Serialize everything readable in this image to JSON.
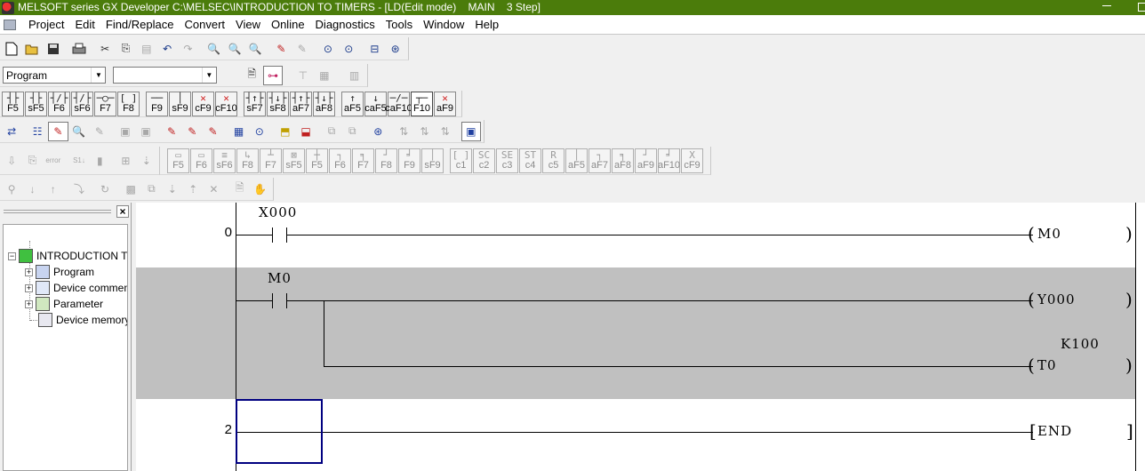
{
  "window": {
    "title": "MELSOFT series GX Developer C:\\MELSEC\\INTRODUCTION TO TIMERS - [LD(Edit mode)    MAIN    3 Step]"
  },
  "menu": [
    "Project",
    "Edit",
    "Find/Replace",
    "Convert",
    "View",
    "Online",
    "Diagnostics",
    "Tools",
    "Window",
    "Help"
  ],
  "toolbar1": {
    "buttons": [
      "new-icon",
      "open-icon",
      "save-icon",
      "print-icon",
      "cut-icon",
      "copy-icon",
      "paste-icon",
      "undo-icon",
      "redo-icon",
      "device-search-icon",
      "instruction-search-icon",
      "character-search-icon",
      "device-replace-icon",
      "instruction-replace-icon",
      "monitor-zoom-icon",
      "monitor-zoom2-icon",
      "display-icon",
      "check-icon"
    ]
  },
  "toolbar2": {
    "data_type": "Program",
    "program_select": ""
  },
  "fkeys_ladder": [
    {
      "sym": "┤├",
      "key": "F5"
    },
    {
      "sym": "┤├",
      "key": "sF5"
    },
    {
      "sym": "┤/├",
      "key": "F6"
    },
    {
      "sym": "┤/├",
      "key": "sF6"
    },
    {
      "sym": "─○─",
      "key": "F7"
    },
    {
      "sym": "[ ]",
      "key": "F8"
    },
    {
      "sym": "──",
      "key": "F9"
    },
    {
      "sym": "│",
      "key": "sF9"
    },
    {
      "sym": "✕",
      "key": "cF9"
    },
    {
      "sym": "✕",
      "key": "cF10"
    },
    {
      "sym": "┤↑├",
      "key": "sF7"
    },
    {
      "sym": "┤↓├",
      "key": "sF8"
    },
    {
      "sym": "┤↑├",
      "key": "aF7"
    },
    {
      "sym": "┤↓├",
      "key": "aF8"
    },
    {
      "sym": "↑",
      "key": "aF5"
    },
    {
      "sym": "↓",
      "key": "caF5"
    },
    {
      "sym": "─/─",
      "key": "caF10"
    },
    {
      "sym": "┬─",
      "key": "F10"
    },
    {
      "sym": "✕",
      "key": "aF9"
    }
  ],
  "fkeys_sfc": [
    {
      "sym": "▭",
      "key": "F5"
    },
    {
      "sym": "▭",
      "key": "F6"
    },
    {
      "sym": "≡",
      "key": "sF6"
    },
    {
      "sym": "↳",
      "key": "F8"
    },
    {
      "sym": "┴",
      "key": "F7"
    },
    {
      "sym": "⊠",
      "key": "sF5"
    },
    {
      "sym": "┼",
      "key": "F5"
    },
    {
      "sym": "┐",
      "key": "F6"
    },
    {
      "sym": "╕",
      "key": "F7"
    },
    {
      "sym": "┘",
      "key": "F8"
    },
    {
      "sym": "╛",
      "key": "F9"
    },
    {
      "sym": "│",
      "key": "sF9"
    },
    {
      "sym": "[ ]",
      "key": "c1"
    },
    {
      "sym": "SC",
      "key": "c2"
    },
    {
      "sym": "SE",
      "key": "c3"
    },
    {
      "sym": "ST",
      "key": "c4"
    },
    {
      "sym": "R",
      "key": "c5"
    },
    {
      "sym": "│",
      "key": "aF5"
    },
    {
      "sym": "┐",
      "key": "aF7"
    },
    {
      "sym": "╕",
      "key": "aF8"
    },
    {
      "sym": "┘",
      "key": "aF9"
    },
    {
      "sym": "╛",
      "key": "aF10"
    },
    {
      "sym": "X",
      "key": "cF9"
    }
  ],
  "project_tree": {
    "root": "INTRODUCTION TO TIMERS",
    "items": [
      "Program",
      "Device comment",
      "Parameter",
      "Device memory"
    ]
  },
  "ladder": {
    "rungs": [
      {
        "step": "0",
        "contact": "X000",
        "coil": "M0"
      },
      {
        "step": "",
        "contact": "M0",
        "coil": "Y000",
        "branch_coil": "T0",
        "branch_setting": "K100"
      },
      {
        "step": "2",
        "end": "END"
      }
    ]
  }
}
